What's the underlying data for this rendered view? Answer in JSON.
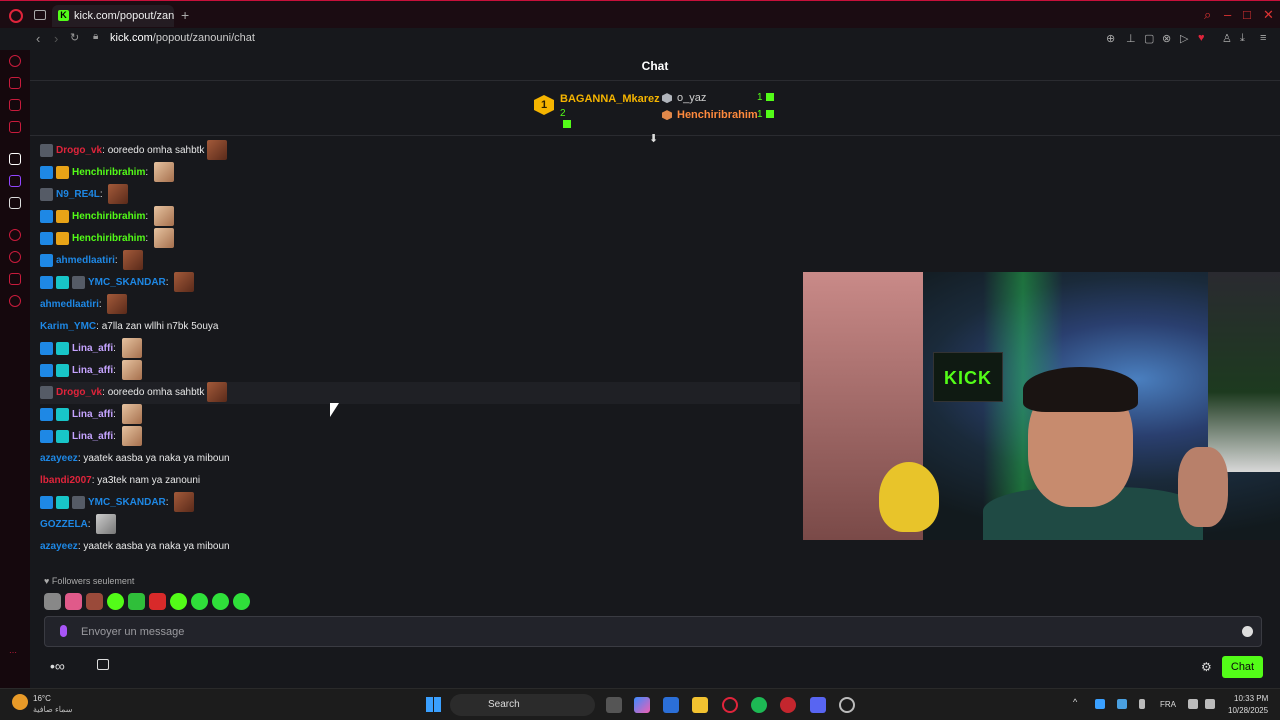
{
  "browser": {
    "tab_title": "kick.com/popout/zanouni",
    "url_host": "kick.com",
    "url_path": "/popout/zanouni/chat",
    "new_tab": "+",
    "tab_favicon": "K"
  },
  "chat": {
    "header_title": "Chat",
    "leaderboard": {
      "first": {
        "rank": "1",
        "name": "BAGANNA_Mkarez",
        "count": "2"
      },
      "others": [
        {
          "name": "o_yaz",
          "count": "1",
          "color": "#cfcfcf",
          "hex": "#b0b4bb"
        },
        {
          "name": "Henchiribrahim",
          "count": "1",
          "color": "#ff8a3d",
          "hex": "#e0884a"
        }
      ]
    },
    "messages": [
      {
        "user": "Drogo_vk",
        "color": "#e0243b",
        "badges": [
          "gray"
        ],
        "text": "ooreedo omha sahbtk",
        "emote": "face",
        "hl": false
      },
      {
        "user": "Henchiribrahim",
        "color": "#53fc18",
        "badges": [
          "blue",
          "gold"
        ],
        "text": "",
        "emote": "light",
        "hl": false
      },
      {
        "user": "N9_RE4L",
        "color": "#1e88e5",
        "badges": [
          "gray"
        ],
        "text": "",
        "emote": "face",
        "hl": false
      },
      {
        "user": "Henchiribrahim",
        "color": "#53fc18",
        "badges": [
          "blue",
          "gold"
        ],
        "text": "",
        "emote": "light",
        "hl": false
      },
      {
        "user": "Henchiribrahim",
        "color": "#53fc18",
        "badges": [
          "blue",
          "gold"
        ],
        "text": "",
        "emote": "light",
        "hl": false
      },
      {
        "user": "ahmedlaatiri",
        "color": "#1e88e5",
        "badges": [
          "blue"
        ],
        "text": "",
        "emote": "face",
        "hl": false
      },
      {
        "user": "YMC_SKANDAR",
        "color": "#1e88e5",
        "badges": [
          "blue",
          "teal",
          "gray"
        ],
        "text": "",
        "emote": "face",
        "hl": false
      },
      {
        "user": "ahmedlaatiri",
        "color": "#1e88e5",
        "badges": [],
        "text": "",
        "emote": "face",
        "hl": false
      },
      {
        "user": "Karim_YMC",
        "color": "#1e88e5",
        "badges": [],
        "text": "a7lla zan wllhi n7bk 5ouya",
        "emote": "",
        "hl": false
      },
      {
        "user": "Lina_affi",
        "color": "#c5a3ff",
        "badges": [
          "blue",
          "teal"
        ],
        "text": "",
        "emote": "light",
        "hl": false
      },
      {
        "user": "Lina_affi",
        "color": "#c5a3ff",
        "badges": [
          "blue",
          "teal"
        ],
        "text": "",
        "emote": "light",
        "hl": false
      },
      {
        "user": "Drogo_vk",
        "color": "#e0243b",
        "badges": [
          "gray"
        ],
        "text": "ooreedo omha sahbtk",
        "emote": "face",
        "hl": true
      },
      {
        "user": "Lina_affi",
        "color": "#c5a3ff",
        "badges": [
          "blue",
          "teal"
        ],
        "text": "",
        "emote": "light",
        "hl": false
      },
      {
        "user": "Lina_affi",
        "color": "#c5a3ff",
        "badges": [
          "blue",
          "teal"
        ],
        "text": "",
        "emote": "light",
        "hl": false
      },
      {
        "user": "azayeez",
        "color": "#1e88e5",
        "badges": [],
        "text": "yaatek aasba ya naka ya miboun",
        "emote": "",
        "hl": false
      },
      {
        "user": "lbandi2007",
        "color": "#e0243b",
        "badges": [],
        "text": "ya3tek nam ya zanouni",
        "emote": "",
        "hl": false
      },
      {
        "user": "YMC_SKANDAR",
        "color": "#1e88e5",
        "badges": [
          "blue",
          "teal",
          "gray"
        ],
        "text": "",
        "emote": "face",
        "hl": false
      },
      {
        "user": "GOZZELA",
        "color": "#1e88e5",
        "badges": [],
        "text": "",
        "emote": "gray",
        "hl": false
      },
      {
        "user": "azayeez",
        "color": "#1e88e5",
        "badges": [],
        "text": "yaatek aasba ya naka ya miboun",
        "emote": "",
        "hl": false
      }
    ],
    "followers_only": "Followers seulement",
    "input_placeholder": "Envoyer un message",
    "send_label": "Chat",
    "video_sign": "KICK"
  },
  "taskbar": {
    "weather_temp": "16°C",
    "weather_desc": "سماء صافية",
    "search_label": "Search",
    "lang": "FRA",
    "time": "10:33 PM",
    "date": "10/28/2025"
  },
  "colors": {
    "accent": "#53fc18",
    "brand_red": "#e0243b"
  }
}
